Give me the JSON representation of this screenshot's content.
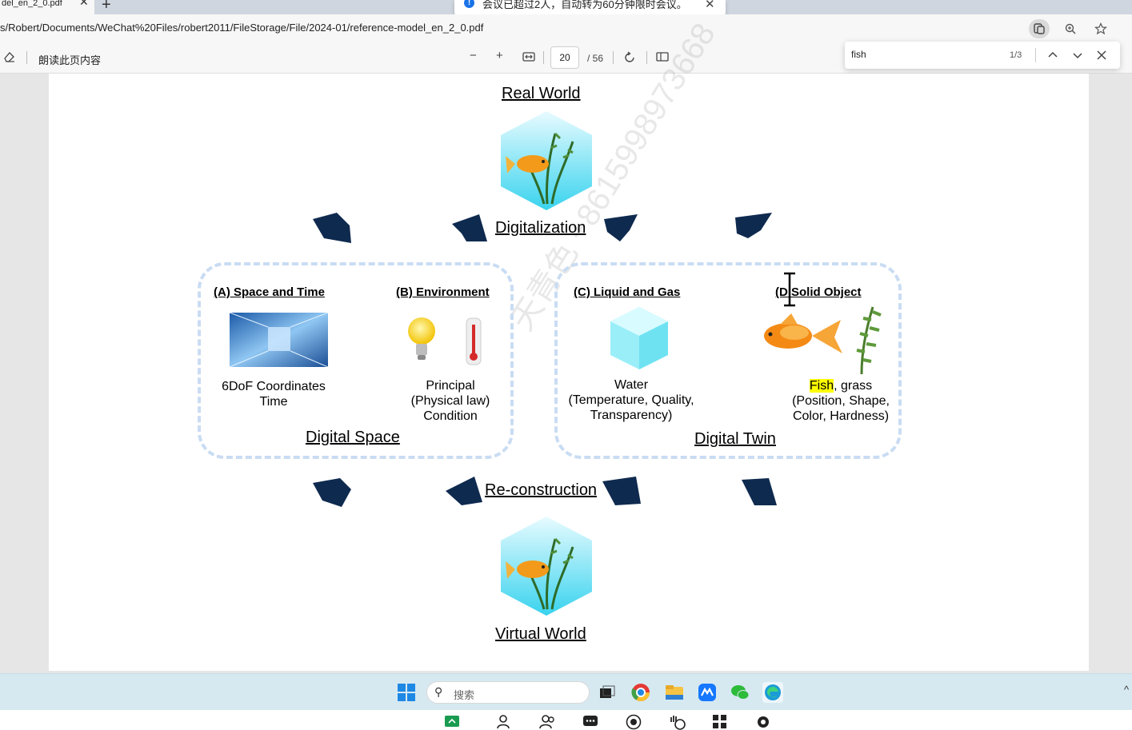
{
  "tab": {
    "title": "del_en_2_0.pdf",
    "close": "✕",
    "new": "+"
  },
  "notice": {
    "text": "会议已超过2人，自动转为60分钟限时会议。",
    "close": "✕"
  },
  "address": {
    "url": "s/Robert/Documents/WeChat%20Files/robert2011/FileStorage/File/2024-01/reference-model_en_2_0.pdf"
  },
  "toolbar": {
    "read_aloud": "朗读此页内容",
    "page_current": "20",
    "page_total": "/ 56",
    "zoom_out": "−",
    "zoom_in": "+"
  },
  "find": {
    "query": "fish",
    "count": "1/3"
  },
  "figure": {
    "real_world": "Real World",
    "digitalization": "Digitalization",
    "reconstruction": "Re-construction",
    "virtual_world": "Virtual World",
    "digital_space": "Digital Space",
    "digital_twin": "Digital Twin",
    "heading_a": "(A) Space and Time",
    "heading_b": "(B) Environment",
    "heading_c": "(C) Liquid and Gas",
    "heading_d_left": "(D",
    "heading_d_right": " Solid Object",
    "caption_a_1": "6DoF Coordinates",
    "caption_a_2": "Time",
    "caption_b_1": "Principal",
    "caption_b_2": "(Physical law)",
    "caption_b_3": "Condition",
    "caption_c_1": "Water",
    "caption_c_2": "(Temperature, Quality,",
    "caption_c_3": "Transparency)",
    "caption_d_fish": "Fish",
    "caption_d_1": ", grass",
    "caption_d_2": "(Position, Shape,",
    "caption_d_3": "Color, Hardness)"
  },
  "watermark": "天青色 +8615998973668",
  "taskbar": {
    "search": "搜索"
  },
  "colors": {
    "arrow": "#0f2a4f",
    "dash": "#c9dcf3",
    "highlight": "#ffff00",
    "accent": "#1a73e8"
  }
}
